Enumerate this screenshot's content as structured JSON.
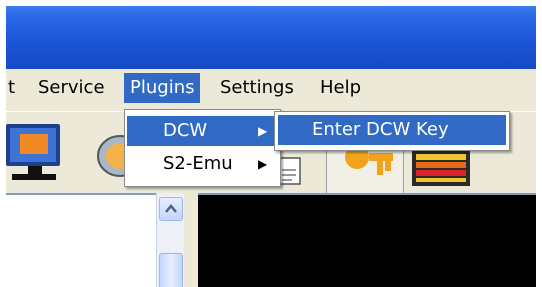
{
  "menubar": {
    "items": [
      {
        "label": "t"
      },
      {
        "label": "Service"
      },
      {
        "label": "Plugins"
      },
      {
        "label": "Settings"
      },
      {
        "label": "Help"
      }
    ]
  },
  "plugins_menu": {
    "items": [
      {
        "label": "DCW",
        "arrow": "▶"
      },
      {
        "label": "S2-Emu",
        "arrow": "▶"
      }
    ]
  },
  "dcw_submenu": {
    "items": [
      {
        "label": "Enter DCW Key"
      }
    ]
  },
  "colors": {
    "titlebar": "#1b56d8",
    "highlight": "#316ac5",
    "menu_bg": "#ece9d8",
    "right_panel": "#000000"
  }
}
